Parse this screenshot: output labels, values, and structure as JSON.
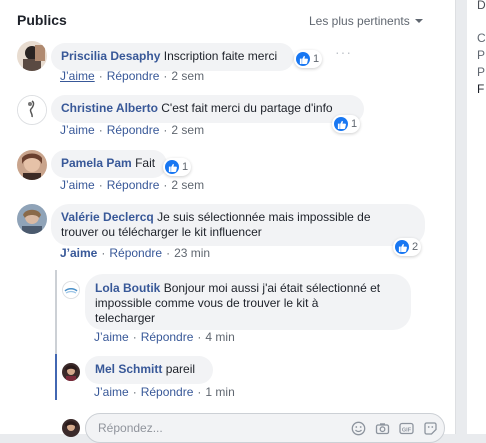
{
  "header": {
    "title": "Publics",
    "sort_label": "Les plus pertinents"
  },
  "side": {
    "tab_letter": "D",
    "letters": [
      "C",
      "P",
      "P",
      "F"
    ]
  },
  "comments": [
    {
      "author": "Priscilia Desaphy",
      "text": "Inscription faite merci",
      "likes": "1",
      "actions": {
        "like": "J’aime",
        "reply": "Répondre",
        "time": "2 sem"
      }
    },
    {
      "author": "Christine Alberto",
      "text": "C'est fait merci du partage d'info",
      "likes": "1",
      "actions": {
        "like": "J’aime",
        "reply": "Répondre",
        "time": "2 sem"
      }
    },
    {
      "author": "Pamela Pam",
      "text": "Fait",
      "likes": "1",
      "actions": {
        "like": "J’aime",
        "reply": "Répondre",
        "time": "2 sem"
      }
    },
    {
      "author": "Valérie Declercq",
      "text_line1": "Je suis sélectionnée mais impossible de",
      "text_line2": "trouver ou télécharger le kit influencer",
      "likes": "2",
      "actions": {
        "like": "J’aime",
        "reply": "Répondre",
        "time": "23 min"
      }
    }
  ],
  "replies": [
    {
      "author": "Lola Boutik",
      "text_line1": "Bonjour moi aussi j'ai était sélectionné et",
      "text_line2": "impossible comme vous de trouver le kit à",
      "text_line3": "telecharger",
      "actions": {
        "like": "J’aime",
        "reply": "Répondre",
        "time": "4 min"
      }
    },
    {
      "author": "Mel Schmitt",
      "text": "pareil",
      "actions": {
        "like": "J’aime",
        "reply": "Répondre",
        "time": "1 min"
      }
    }
  ],
  "reply_box": {
    "placeholder": "Répondez..."
  },
  "separator": "·",
  "colors": {
    "link": "#385898",
    "like_blue": "#1877f2",
    "bubble": "#f2f3f5"
  }
}
